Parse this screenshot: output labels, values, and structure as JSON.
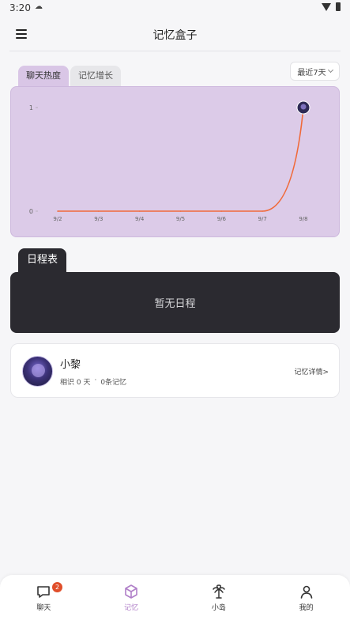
{
  "status": {
    "time": "3:20"
  },
  "header": {
    "title": "记忆盒子"
  },
  "tabs": [
    {
      "label": "聊天热度",
      "active": true
    },
    {
      "label": "记忆增长",
      "active": false
    }
  ],
  "range_select": {
    "value": "最近7天"
  },
  "chart_data": {
    "type": "line",
    "categories": [
      "9/2",
      "9/3",
      "9/4",
      "9/5",
      "9/6",
      "9/7",
      "9/8"
    ],
    "series": [
      {
        "values": [
          0,
          0,
          0,
          0,
          0,
          0,
          1
        ]
      }
    ],
    "y_ticks": [
      "1",
      "0"
    ],
    "ylim": [
      0,
      1
    ],
    "line_color": "#f06a3a",
    "background": "#dccbe8",
    "grid": false,
    "endpoint_marker": "avatar"
  },
  "schedule": {
    "tab_label": "日程表",
    "empty_text": "暂无日程"
  },
  "memory_card": {
    "name": "小黎",
    "days": "相识 0 天",
    "separator": "·",
    "count": "0条记忆",
    "link": "记忆详情>"
  },
  "nav": [
    {
      "label": "聊天",
      "icon": "chat-icon",
      "badge": "2",
      "active": false
    },
    {
      "label": "记忆",
      "icon": "box-icon",
      "active": true
    },
    {
      "label": "小岛",
      "icon": "palm-tree-icon",
      "active": false
    },
    {
      "label": "我的",
      "icon": "user-icon",
      "active": false
    }
  ],
  "colors": {
    "accent": "#b07fc8",
    "chart_bg": "#dccbe8",
    "dark_card": "#2b2a30"
  }
}
